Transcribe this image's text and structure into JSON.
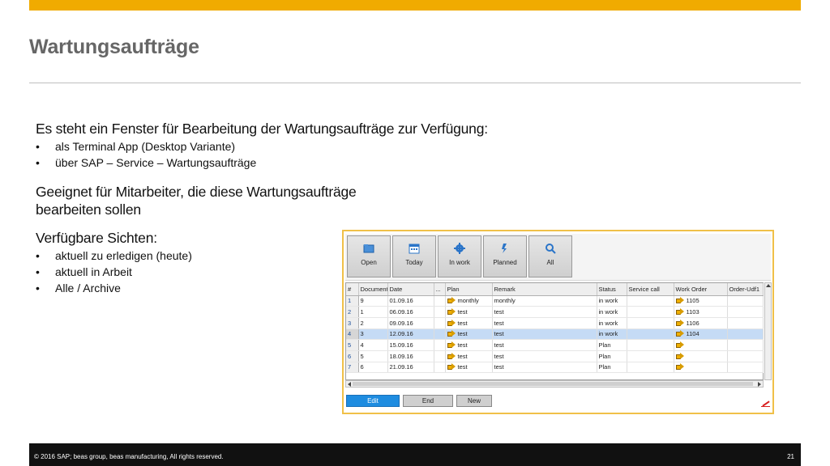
{
  "slide": {
    "title": "Wartungsaufträge",
    "para1": "Es steht ein Fenster für Bearbeitung der Wartungsaufträge zur Verfügung:",
    "bullets1": [
      "als Terminal App (Desktop Variante)",
      "über SAP – Service – Wartungsaufträge"
    ],
    "para2_line1": "Geeignet für Mitarbeiter, die diese Wartungsaufträge",
    "para2_line2": "bearbeiten sollen",
    "para3": "Verfügbare Sichten:",
    "bullets2": [
      "aktuell zu erledigen (heute)",
      "aktuell in Arbeit",
      "Alle / Archive"
    ],
    "bullet_char": "•"
  },
  "app": {
    "toolbar": [
      {
        "label": "Open",
        "icon": "folder-icon"
      },
      {
        "label": "Today",
        "icon": "calendar-icon"
      },
      {
        "label": "In work",
        "icon": "gear-icon"
      },
      {
        "label": "Planned",
        "icon": "flag-icon"
      },
      {
        "label": "All",
        "icon": "search-icon"
      }
    ],
    "columns": [
      "#",
      "Document",
      "Date",
      "...",
      "Plan",
      "Remark",
      "Status",
      "Service call",
      "Work Order",
      "Order-Udf1"
    ],
    "rows": [
      {
        "num": "1",
        "doc": "9",
        "date": "01.09.16",
        "plan": "monthly",
        "remark": "monthly",
        "status": "in work",
        "service": "",
        "work_order": "1105"
      },
      {
        "num": "2",
        "doc": "1",
        "date": "06.09.16",
        "plan": "test",
        "remark": "test",
        "status": "in work",
        "service": "",
        "work_order": "1103"
      },
      {
        "num": "3",
        "doc": "2",
        "date": "09.09.16",
        "plan": "test",
        "remark": "test",
        "status": "in work",
        "service": "",
        "work_order": "1106"
      },
      {
        "num": "4",
        "doc": "3",
        "date": "12.09.16",
        "plan": "test",
        "remark": "test",
        "status": "in work",
        "service": "",
        "work_order": "1104"
      },
      {
        "num": "5",
        "doc": "4",
        "date": "15.09.16",
        "plan": "test",
        "remark": "test",
        "status": "Plan",
        "service": "",
        "work_order": ""
      },
      {
        "num": "6",
        "doc": "5",
        "date": "18.09.16",
        "plan": "test",
        "remark": "test",
        "status": "Plan",
        "service": "",
        "work_order": ""
      },
      {
        "num": "7",
        "doc": "6",
        "date": "21.09.16",
        "plan": "test",
        "remark": "test",
        "status": "Plan",
        "service": "",
        "work_order": ""
      }
    ],
    "selected_row": 4,
    "buttons": {
      "edit": "Edit",
      "end": "End",
      "new": "New"
    }
  },
  "footer": {
    "copyright": "©  2016 SAP; beas group, beas manufacturing,  All rights reserved.",
    "page": "21"
  },
  "colors": {
    "accent": "#f0ab00",
    "selection": "#c5dbf5",
    "primary_button": "#1e8ce0"
  }
}
